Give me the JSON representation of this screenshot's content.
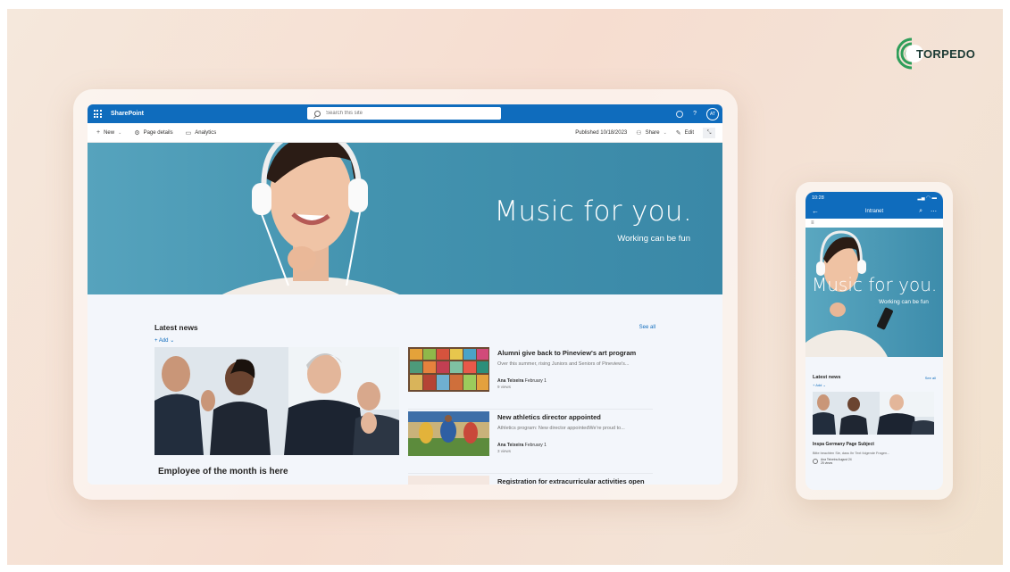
{
  "brand": {
    "logo_text": "TORPEDO",
    "accent": "#0f6cbd",
    "logo_color": "#1b3a34"
  },
  "desktop": {
    "app_title": "SharePoint",
    "search_placeholder": "Search this site",
    "help_label": "?",
    "avatar_initials": "AT",
    "commands": {
      "new_label": "New",
      "page_details_label": "Page details",
      "analytics_label": "Analytics",
      "published_label": "Published 10/18/2023",
      "share_label": "Share",
      "edit_label": "Edit"
    },
    "hero": {
      "title": "Music for you.",
      "subtitle": "Working can be fun"
    },
    "news": {
      "title": "Latest news",
      "see_all": "See all",
      "add_label": "Add",
      "main_headline": "Employee of the month is here",
      "items": [
        {
          "title": "Alumni give back to Pineview's art program",
          "desc": "Over this summer, rising Juniors and Seniors of Pineview's...",
          "author": "Ana Teixeira",
          "date": "February 1",
          "views": "9 views"
        },
        {
          "title": "New athletics director appointed",
          "desc": "Athletics program: New director appointedWe're proud to...",
          "author": "Ana Teixeira",
          "date": "February 1",
          "views": "3 views"
        },
        {
          "title": "Registration for extracurricular activities open"
        }
      ]
    }
  },
  "mobile": {
    "time": "10:28",
    "nav_title": "Intranet",
    "hero": {
      "title": "Music for you.",
      "subtitle": "Working can be fun"
    },
    "news": {
      "title": "Latest news",
      "see_all": "See all",
      "add_label": "Add",
      "headline": "Inspa Germany Page Subject",
      "desc": "Bitte beachten Sie, dass Ihr Text folgende Fragen...",
      "author": "Ana Teixeira",
      "date": "August 24",
      "views": "25 views"
    }
  }
}
